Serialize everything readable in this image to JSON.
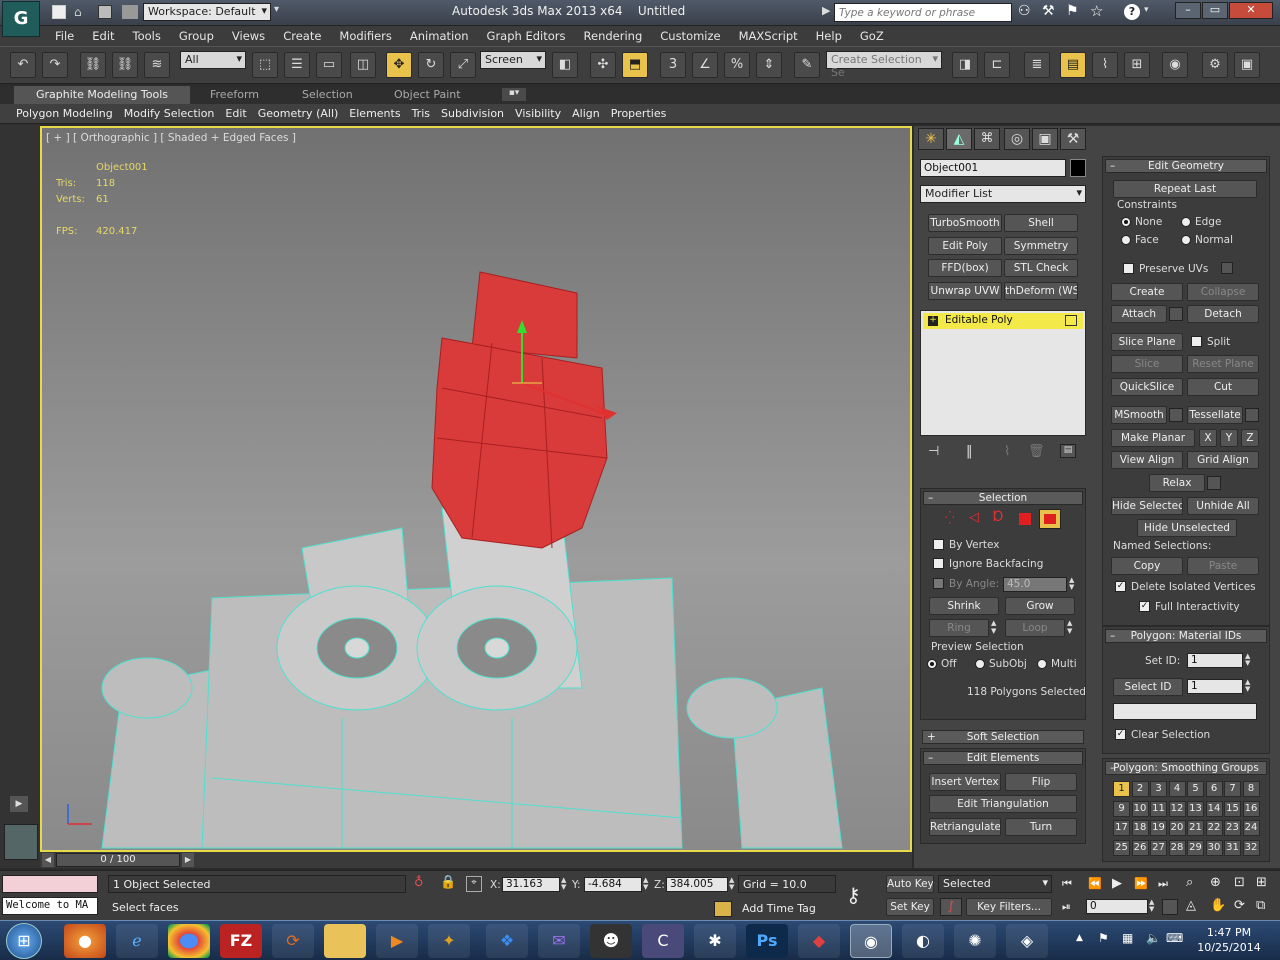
{
  "title": {
    "workspace": "Workspace: Default",
    "app": "Autodesk 3ds Max  2013 x64",
    "doc": "Untitled",
    "search_placeholder": "Type a keyword or phrase"
  },
  "menu": [
    "File",
    "Edit",
    "Tools",
    "Group",
    "Views",
    "Create",
    "Modifiers",
    "Animation",
    "Graph Editors",
    "Rendering",
    "Customize",
    "MAXScript",
    "Help",
    "GoZ"
  ],
  "toolbar": {
    "filter": "All",
    "refcoord": "Screen",
    "selset_placeholder": "Create Selection Se",
    "snap_label": "3"
  },
  "ribbon": {
    "tabs": [
      "Graphite Modeling Tools",
      "Freeform",
      "Selection",
      "Object Paint"
    ],
    "sub": [
      "Polygon Modeling",
      "Modify Selection",
      "Edit",
      "Geometry (All)",
      "Elements",
      "Tris",
      "Subdivision",
      "Visibility",
      "Align",
      "Properties"
    ]
  },
  "viewport": {
    "label": "[ + ] [ Orthographic ] [ Shaded + Edged Faces ]",
    "object": "Object001",
    "tris_label": "Tris:",
    "tris": "118",
    "verts_label": "Verts:",
    "verts": "61",
    "fps_label": "FPS:",
    "fps": "420.417"
  },
  "command": {
    "object_name": "Object001",
    "modifier_list": "Modifier List",
    "mod_buttons": [
      "TurboSmooth",
      "Shell",
      "Edit Poly",
      "Symmetry",
      "FFD(box)",
      "STL Check",
      "Unwrap UVW",
      "thDeform (WSI"
    ],
    "stack_item": "Editable Poly",
    "selection": {
      "title": "Selection",
      "by_vertex": "By Vertex",
      "ignore_backfacing": "Ignore Backfacing",
      "by_angle": "By Angle:",
      "angle": "45.0",
      "shrink": "Shrink",
      "grow": "Grow",
      "ring": "Ring",
      "loop": "Loop",
      "preview": "Preview Selection",
      "off": "Off",
      "subobj": "SubObj",
      "multi": "Multi",
      "status": "118 Polygons Selected"
    },
    "soft_selection": "Soft Selection",
    "edit_elements": {
      "title": "Edit Elements",
      "insert_vertex": "Insert Vertex",
      "flip": "Flip",
      "edit_triangulation": "Edit Triangulation",
      "retriangulate": "Retriangulate",
      "turn": "Turn"
    },
    "edit_geometry": {
      "title": "Edit Geometry",
      "repeat_last": "Repeat Last",
      "constraints": "Constraints",
      "none": "None",
      "edge": "Edge",
      "face": "Face",
      "normal": "Normal",
      "preserve_uvs": "Preserve UVs",
      "create": "Create",
      "collapse": "Collapse",
      "attach": "Attach",
      "detach": "Detach",
      "slice_plane": "Slice Plane",
      "split": "Split",
      "slice": "Slice",
      "reset_plane": "Reset Plane",
      "quickslice": "QuickSlice",
      "cut": "Cut",
      "msmooth": "MSmooth",
      "tessellate": "Tessellate",
      "make_planar": "Make Planar",
      "x": "X",
      "y": "Y",
      "z": "Z",
      "view_align": "View Align",
      "grid_align": "Grid Align",
      "relax": "Relax",
      "hide_selected": "Hide Selected",
      "unhide_all": "Unhide All",
      "hide_unselected": "Hide Unselected",
      "named_selections": "Named Selections:",
      "copy": "Copy",
      "paste": "Paste",
      "delete_isolated": "Delete Isolated Vertices",
      "full_interactivity": "Full Interactivity"
    },
    "material_ids": {
      "title": "Polygon: Material IDs",
      "set_id_label": "Set ID:",
      "set_id": "1",
      "select_id": "Select ID",
      "select_val": "1",
      "clear_selection": "Clear Selection"
    },
    "smoothing": {
      "title": "Polygon: Smoothing Groups",
      "groups": [
        "1",
        "2",
        "3",
        "4",
        "5",
        "6",
        "7",
        "8",
        "9",
        "10",
        "11",
        "12",
        "13",
        "14",
        "15",
        "16",
        "17",
        "18",
        "19",
        "20",
        "21",
        "22",
        "23",
        "24",
        "25",
        "26",
        "27",
        "28",
        "29",
        "30",
        "31",
        "32"
      ]
    }
  },
  "timeline": {
    "frame": "0 / 100"
  },
  "status": {
    "selected": "1 Object Selected",
    "prompt": "Select faces",
    "welcome": "Welcome to MA",
    "x_label": "X:",
    "x": "31.163",
    "y_label": "Y:",
    "y": "-4.684",
    "z_label": "Z:",
    "z": "384.005",
    "grid": "Grid = 10.0",
    "add_time_tag": "Add Time Tag",
    "auto_key": "Auto Key",
    "set_key": "Set Key",
    "key_mode": "Selected",
    "key_filters": "Key Filters...",
    "frame_field": "0"
  },
  "clock": {
    "time": "1:47 PM",
    "date": "10/25/2014"
  },
  "colors": {
    "accent": "#e8c24a",
    "selection": "#d93a3a",
    "wire": "#4de0d0"
  }
}
